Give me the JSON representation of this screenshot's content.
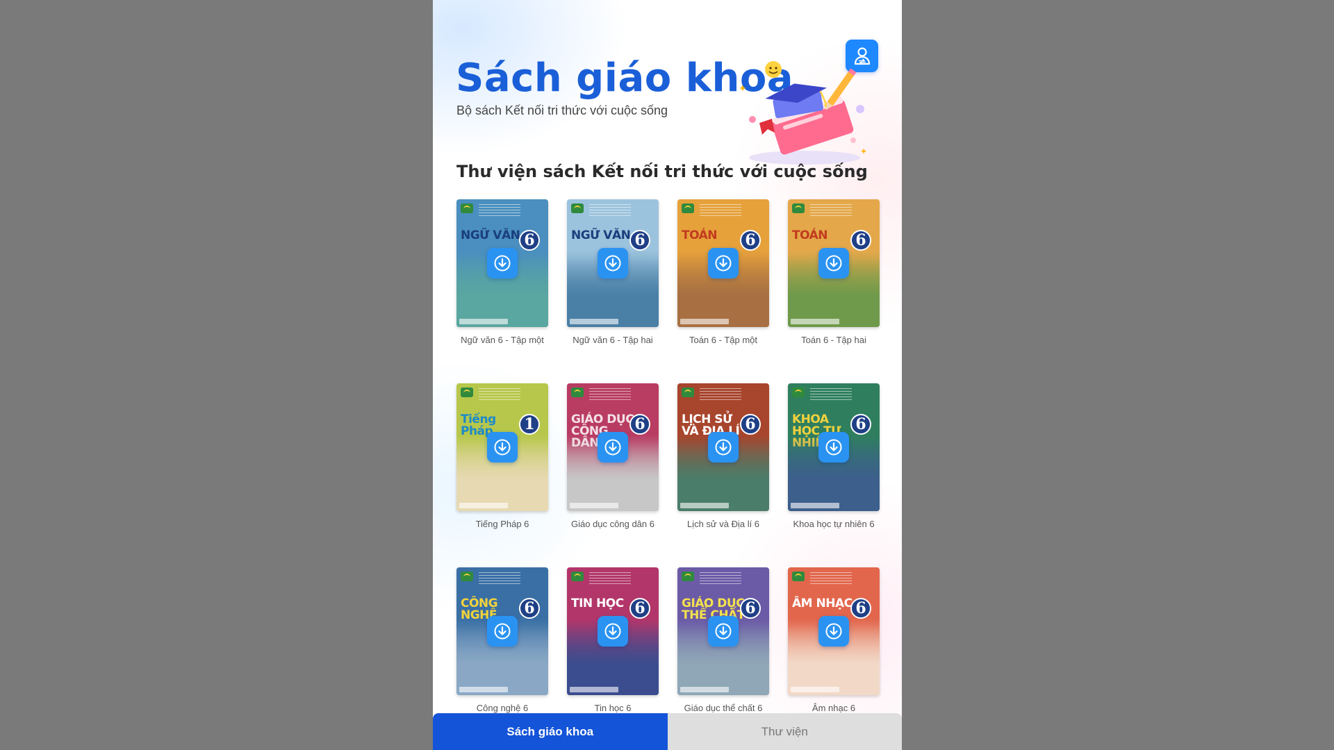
{
  "header": {
    "title": "Sách giáo khoa",
    "subtitle": "Bộ sách Kết nối tri thức với cuộc sống"
  },
  "section_title": "Thư viện sách Kết nối tri thức với cuộc sống",
  "books": [
    {
      "label": "Ngữ văn 6 - Tập một",
      "cover_title": "NGỮ VĂN",
      "grade": "6",
      "bg": "#4a8fbf",
      "title_color": "#1a3e7d",
      "scene": "#5aa6a0"
    },
    {
      "label": "Ngữ văn 6 - Tập hai",
      "cover_title": "NGỮ VĂN",
      "grade": "6",
      "bg": "#9cc3dd",
      "title_color": "#1a3e7d",
      "scene": "#4a7fa6"
    },
    {
      "label": "Toán 6 - Tập một",
      "cover_title": "TOÁN",
      "grade": "6",
      "bg": "#e6a13b",
      "title_color": "#c23b1f",
      "scene": "#a87042"
    },
    {
      "label": "Toán 6 - Tập hai",
      "cover_title": "TOÁN",
      "grade": "6",
      "bg": "#e4a84a",
      "title_color": "#c23b1f",
      "scene": "#6f9a4b"
    },
    {
      "label": "Tiếng Pháp 6",
      "cover_title": "Tiếng Pháp",
      "grade": "1",
      "bg": "#b7c74b",
      "title_color": "#1d8ac9",
      "scene": "#e7d9b2"
    },
    {
      "label": "Giáo dục công dân 6",
      "cover_title": "GIÁO DỤC CÔNG DÂN",
      "grade": "6",
      "bg": "#b93c63",
      "title_color": "#f5e0e8",
      "scene": "#c7c7c7"
    },
    {
      "label": "Lịch sử và Địa lí 6",
      "cover_title": "LỊCH SỬ VÀ ĐỊA LÍ",
      "grade": "6",
      "bg": "#a8452d",
      "title_color": "#ffffff",
      "scene": "#4a7d6a"
    },
    {
      "label": "Khoa học tự nhiên 6",
      "cover_title": "KHOA HỌC TỰ NHIÊN",
      "grade": "6",
      "bg": "#2f7f5f",
      "title_color": "#f1d23e",
      "scene": "#3c5f8c"
    },
    {
      "label": "Công nghệ 6",
      "cover_title": "CÔNG NGHỆ",
      "grade": "6",
      "bg": "#3a6fa5",
      "title_color": "#f2d33a",
      "scene": "#8aa8c5"
    },
    {
      "label": "Tin học 6",
      "cover_title": "TIN HỌC",
      "grade": "6",
      "bg": "#b2366a",
      "title_color": "#ffffff",
      "scene": "#3b4d8f"
    },
    {
      "label": "Giáo dục thể chất 6",
      "cover_title": "GIÁO DỤC THỂ CHẤT",
      "grade": "6",
      "bg": "#6b5aa6",
      "title_color": "#f3e14d",
      "scene": "#8fa7b7"
    },
    {
      "label": "Âm nhạc 6",
      "cover_title": "ÂM NHẠC",
      "grade": "6",
      "bg": "#e2664c",
      "title_color": "#ffffff",
      "scene": "#f2d9c7"
    }
  ],
  "tabs": [
    {
      "label": "Sách giáo khoa",
      "active": true
    },
    {
      "label": "Thư viện",
      "active": false
    }
  ],
  "icons": {
    "account": "account-switch-icon",
    "download": "download-icon"
  },
  "colors": {
    "brand_blue": "#1a5fd8",
    "button_blue": "#2a93f2",
    "active_tab": "#1454d9",
    "inactive_tab": "#dedede"
  }
}
